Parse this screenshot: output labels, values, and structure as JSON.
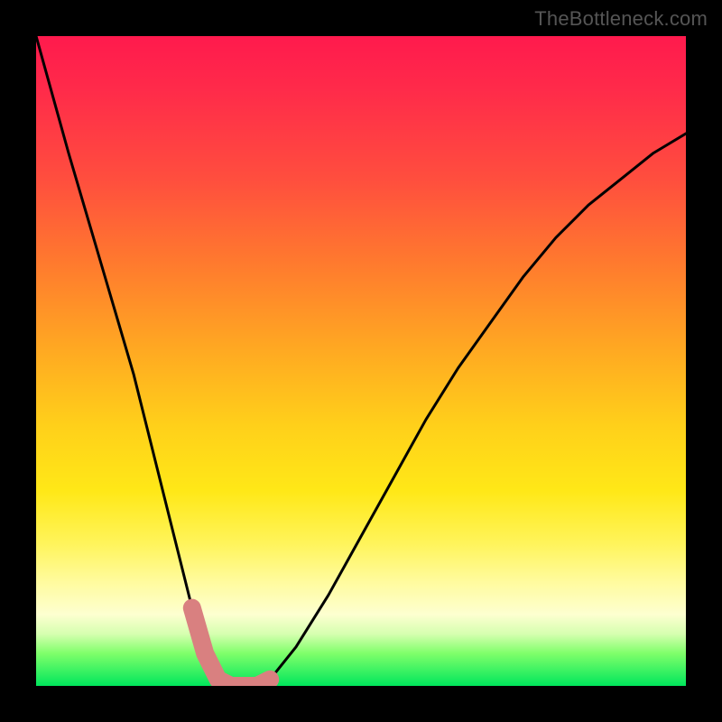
{
  "watermark": "TheBottleneck.com",
  "chart_data": {
    "type": "line",
    "title": "",
    "xlabel": "",
    "ylabel": "",
    "xlim": [
      0,
      100
    ],
    "ylim": [
      0,
      100
    ],
    "series": [
      {
        "name": "bottleneck-curve",
        "x": [
          0,
          5,
          10,
          15,
          18,
          21,
          24,
          26,
          28,
          30,
          32,
          34,
          36,
          40,
          45,
          50,
          55,
          60,
          65,
          70,
          75,
          80,
          85,
          90,
          95,
          100
        ],
        "values": [
          100,
          82,
          65,
          48,
          36,
          24,
          12,
          5,
          1,
          0,
          0,
          0,
          1,
          6,
          14,
          23,
          32,
          41,
          49,
          56,
          63,
          69,
          74,
          78,
          82,
          85
        ]
      }
    ],
    "marker_region": {
      "name": "optimal-zone",
      "x": [
        24,
        26,
        28,
        30,
        32,
        34,
        36
      ],
      "values": [
        12,
        5,
        1,
        0,
        0,
        0,
        1
      ]
    },
    "gradient_stops": [
      {
        "pos": 0,
        "color": "#ff1a4d"
      },
      {
        "pos": 22,
        "color": "#ff4e3e"
      },
      {
        "pos": 48,
        "color": "#ffa822"
      },
      {
        "pos": 70,
        "color": "#ffe817"
      },
      {
        "pos": 89,
        "color": "#fdffd0"
      },
      {
        "pos": 100,
        "color": "#00e65c"
      }
    ]
  }
}
